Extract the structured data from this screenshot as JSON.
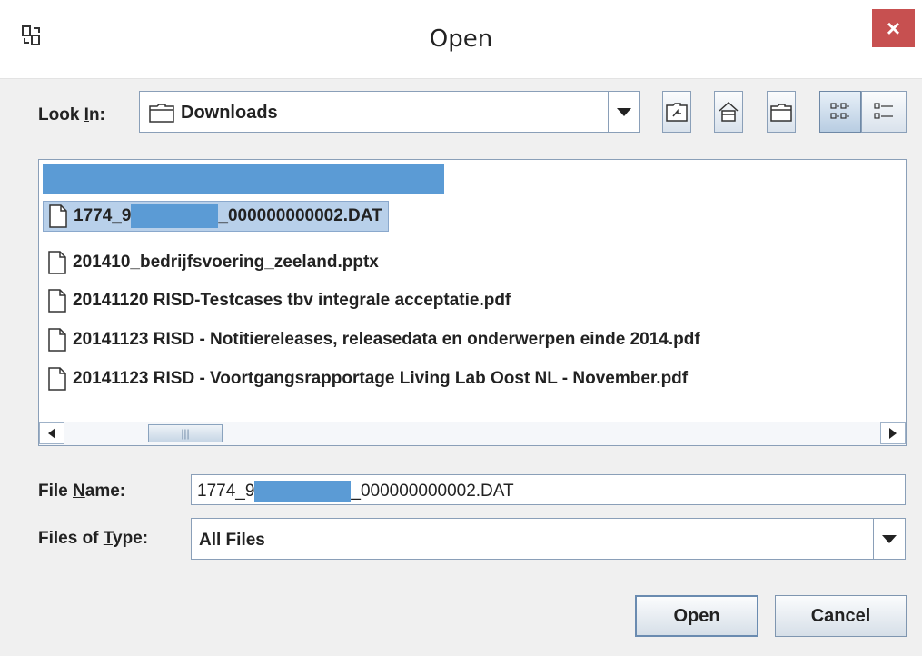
{
  "window": {
    "title": "Open",
    "close_glyph": "×"
  },
  "look_in": {
    "label_pre": "Look ",
    "label_mnemonic": "I",
    "label_post": "n:",
    "value": "Downloads",
    "icon": "folder-icon"
  },
  "toolbar": [
    {
      "name": "up-one-level-button",
      "icon": "up-folder-icon"
    },
    {
      "name": "home-button",
      "icon": "home-icon"
    },
    {
      "name": "new-folder-button",
      "icon": "new-folder-icon"
    },
    {
      "name": "list-view-button",
      "icon": "list-view-icon",
      "active": true
    },
    {
      "name": "details-view-button",
      "icon": "details-view-icon"
    }
  ],
  "files": [
    {
      "prefix": "1774_9",
      "suffix": "_000000000002.DAT",
      "redacted": true,
      "selected": true
    },
    {
      "name": "201410_bedrijfsvoering_zeeland.pptx"
    },
    {
      "name": "20141120 RISD-Testcases tbv integrale acceptatie.pdf"
    },
    {
      "name": "20141123 RISD - Notitiereleases, releasedata en onderwerpen einde 2014.pdf"
    },
    {
      "name": "20141123 RISD - Voortgangsrapportage Living Lab Oost NL - November.pdf"
    }
  ],
  "file_name": {
    "label_pre": "File ",
    "label_mnemonic": "N",
    "label_post": "ame:",
    "value_prefix": "1774_9",
    "value_suffix": "_000000000002.DAT"
  },
  "files_of_type": {
    "label_pre": "Files of ",
    "label_mnemonic": "T",
    "label_post": "ype:",
    "value": "All Files"
  },
  "buttons": {
    "open": "Open",
    "cancel": "Cancel"
  },
  "colors": {
    "selection": "#b8d0ea",
    "redaction": "#5b9bd5",
    "close": "#c75050"
  }
}
